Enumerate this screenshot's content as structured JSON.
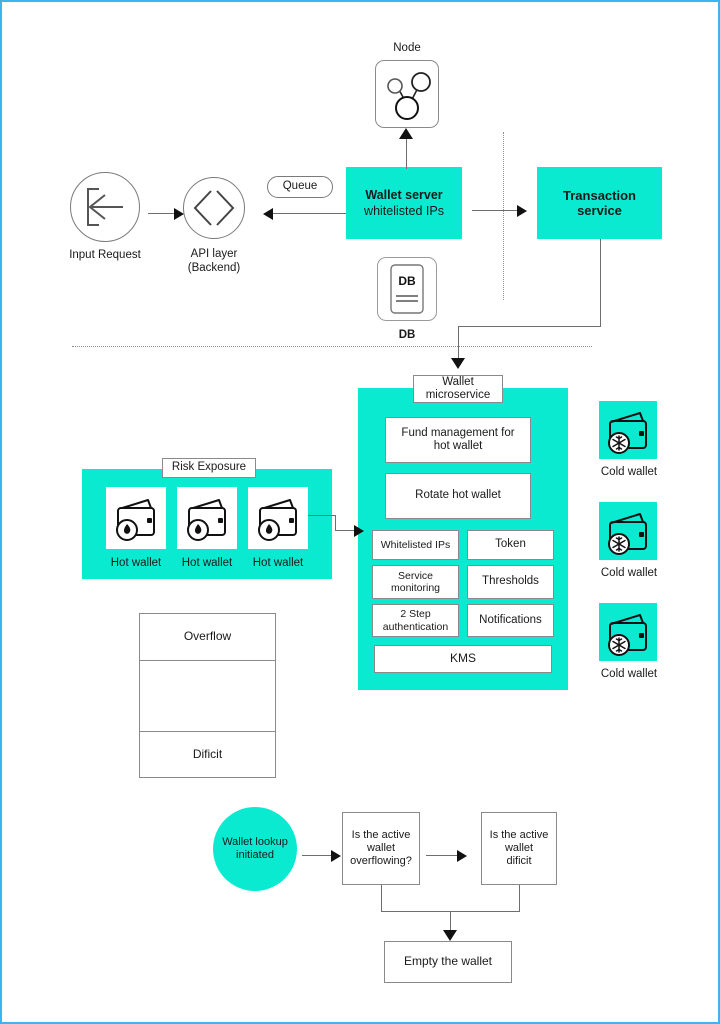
{
  "diagram": {
    "title": "Wallet architecture diagram",
    "accent_color": "#0aead1",
    "border_color": "#3cb4f0",
    "line_color": "#6e6e6e"
  },
  "top_flow": {
    "input_request": {
      "label": "Input Request",
      "icon": "login-arrow-icon"
    },
    "api_layer": {
      "label": "API layer\n(Backend)",
      "line1": "API layer",
      "line2": "(Backend)",
      "icon": "code-brackets-icon"
    },
    "queue": {
      "label": "Queue"
    },
    "wallet_server": {
      "line1": "Wallet server",
      "line2": "whitelisted IPs"
    },
    "node": {
      "label": "Node",
      "icon": "node-network-icon"
    },
    "db": {
      "label": "DB",
      "icon_text": "DB",
      "icon": "database-icon"
    },
    "transaction_service": {
      "line1": "Transaction",
      "line2": "service"
    }
  },
  "risk_exposure": {
    "label": "Risk Exposure",
    "wallets": [
      {
        "label": "Hot wallet",
        "icon": "hot-wallet-icon"
      },
      {
        "label": "Hot wallet",
        "icon": "hot-wallet-icon"
      },
      {
        "label": "Hot wallet",
        "icon": "hot-wallet-icon"
      }
    ]
  },
  "wallet_microservice": {
    "label_line1": "Wallet",
    "label_line2": "microservice",
    "wide_boxes": [
      {
        "line1": "Fund management for",
        "line2": "hot wallet"
      },
      {
        "line1": "Rotate hot wallet",
        "line2": ""
      }
    ],
    "grid": [
      {
        "left_line1": "Whitelisted IPs",
        "left_line2": "",
        "right_line1": "Token",
        "right_line2": ""
      },
      {
        "left_line1": "Service",
        "left_line2": "monitoring",
        "right_line1": "Thresholds",
        "right_line2": ""
      },
      {
        "left_line1": "2 Step",
        "left_line2": "authentication",
        "right_line1": "Notifications",
        "right_line2": ""
      }
    ],
    "footer_box": "KMS"
  },
  "cold_wallets": [
    {
      "label": "Cold wallet",
      "icon": "cold-wallet-icon"
    },
    {
      "label": "Cold wallet",
      "icon": "cold-wallet-icon"
    },
    {
      "label": "Cold wallet",
      "icon": "cold-wallet-icon"
    }
  ],
  "threshold_table": {
    "rows": [
      {
        "label": "Overflow"
      },
      {
        "label": ""
      },
      {
        "label": "Dificit"
      }
    ]
  },
  "bottom_flow": {
    "start": {
      "line1": "Wallet lookup",
      "line2": "initiated"
    },
    "decision_1": {
      "line1": "Is the active",
      "line2": "wallet",
      "line3": "overflowing?"
    },
    "decision_2": {
      "line1": "Is the active",
      "line2": "wallet",
      "line3": "dificit"
    },
    "result": {
      "label": "Empty the wallet"
    }
  }
}
